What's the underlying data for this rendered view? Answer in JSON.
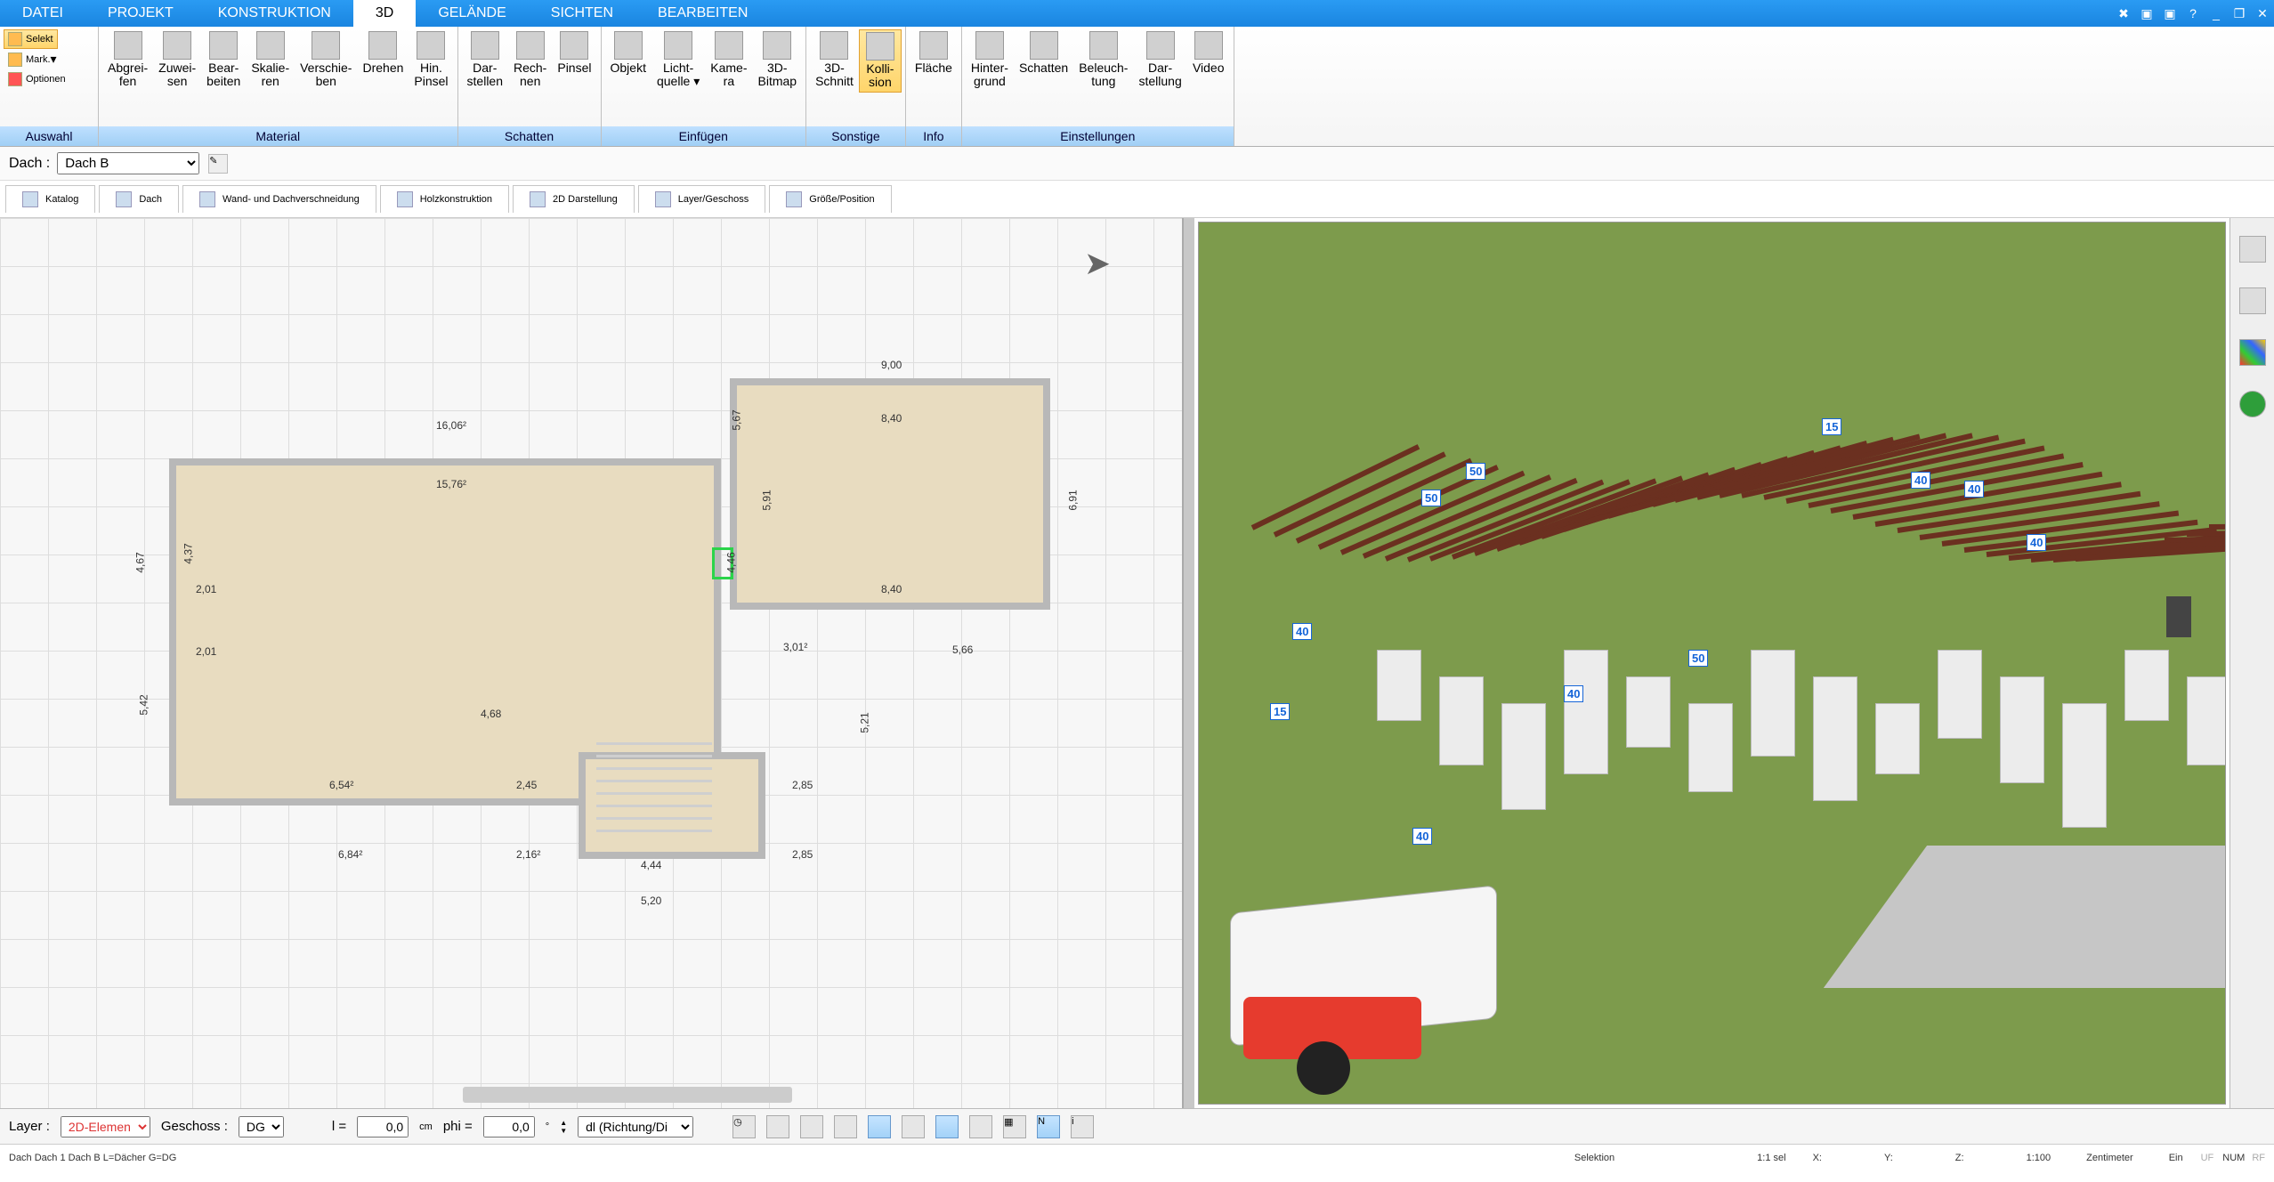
{
  "menu": {
    "tabs": [
      "DATEI",
      "PROJEKT",
      "KONSTRUKTION",
      "3D",
      "GELÄNDE",
      "SICHTEN",
      "BEARBEITEN"
    ],
    "active": 3
  },
  "ribbon": {
    "auswahl": {
      "label": "Auswahl",
      "selekt": "Selekt",
      "mark": "Mark.",
      "optionen": "Optionen"
    },
    "material": {
      "label": "Material",
      "btns": [
        {
          "t1": "Abgrei-",
          "t2": "fen"
        },
        {
          "t1": "Zuwei-",
          "t2": "sen"
        },
        {
          "t1": "Bear-",
          "t2": "beiten"
        },
        {
          "t1": "Skalie-",
          "t2": "ren"
        },
        {
          "t1": "Verschie-",
          "t2": "ben"
        },
        {
          "t1": "Drehen",
          "t2": ""
        },
        {
          "t1": "Hin.",
          "t2": "Pinsel"
        }
      ]
    },
    "schatten": {
      "label": "Schatten",
      "btns": [
        {
          "t1": "Dar-",
          "t2": "stellen"
        },
        {
          "t1": "Rech-",
          "t2": "nen"
        },
        {
          "t1": "Pinsel",
          "t2": ""
        }
      ]
    },
    "einfuegen": {
      "label": "Einfügen",
      "btns": [
        {
          "t1": "Objekt",
          "t2": ""
        },
        {
          "t1": "Licht-",
          "t2": "quelle ▾"
        },
        {
          "t1": "Kame-",
          "t2": "ra"
        },
        {
          "t1": "3D-",
          "t2": "Bitmap"
        }
      ]
    },
    "sonstige": {
      "label": "Sonstige",
      "btns": [
        {
          "t1": "3D-",
          "t2": "Schnitt"
        },
        {
          "t1": "Kolli-",
          "t2": "sion",
          "active": true
        }
      ]
    },
    "info": {
      "label": "Info",
      "btns": [
        {
          "t1": "Fläche",
          "t2": ""
        }
      ]
    },
    "einstellungen": {
      "label": "Einstellungen",
      "btns": [
        {
          "t1": "Hinter-",
          "t2": "grund"
        },
        {
          "t1": "Schatten",
          "t2": ""
        },
        {
          "t1": "Beleuch-",
          "t2": "tung"
        },
        {
          "t1": "Dar-",
          "t2": "stellung"
        },
        {
          "t1": "Video",
          "t2": ""
        }
      ]
    }
  },
  "context": {
    "label": "Dach :",
    "value": "Dach B"
  },
  "proptabs": [
    "Katalog",
    "Dach",
    "Wand- und Dachverschneidung",
    "Holzkonstruktion",
    "2D Darstellung",
    "Layer/Geschoss",
    "Größe/Position"
  ],
  "plan": {
    "dims": {
      "d1": "16,06²",
      "d2": "9,00",
      "d3": "8,40",
      "d4": "8,40",
      "d5": "15,76²",
      "d6": "2,01",
      "d7": "2,01",
      "d8": "5,42",
      "d9": "4,37",
      "d10": "6,91",
      "d11": "5,91",
      "d12": "4,68",
      "d13": "3,01²",
      "d14": "5,66",
      "d15": "5,21",
      "d16": "6,54²",
      "d17": "2,45",
      "d18": "2,85",
      "d19": "6,84²",
      "d20": "2,16²",
      "d21": "4,44",
      "d22": "2,85",
      "d23": "5,20",
      "d24": "5,67",
      "d25": "4,67",
      "d26": "4,46"
    }
  },
  "badges": [
    "50",
    "50",
    "40",
    "40",
    "40",
    "15",
    "15",
    "50",
    "40",
    "40",
    "40"
  ],
  "bottom": {
    "layer_label": "Layer :",
    "layer": "2D-Elemen",
    "geschoss_label": "Geschoss :",
    "geschoss": "DG",
    "l_label": "l =",
    "l_val": "0,0",
    "unit": "cm",
    "phi_label": "phi =",
    "phi_val": "0,0",
    "dl": "dl (Richtung/Di"
  },
  "status": {
    "left": "Dach Dach 1 Dach B L=Dächer G=DG",
    "sel": "Selektion",
    "scale": "1:1 sel",
    "x": "X:",
    "y": "Y:",
    "z": "Z:",
    "mscale": "1:100",
    "unit": "Zentimeter",
    "mode": "Ein",
    "uf": "UF",
    "num": "NUM",
    "rf": "RF"
  }
}
